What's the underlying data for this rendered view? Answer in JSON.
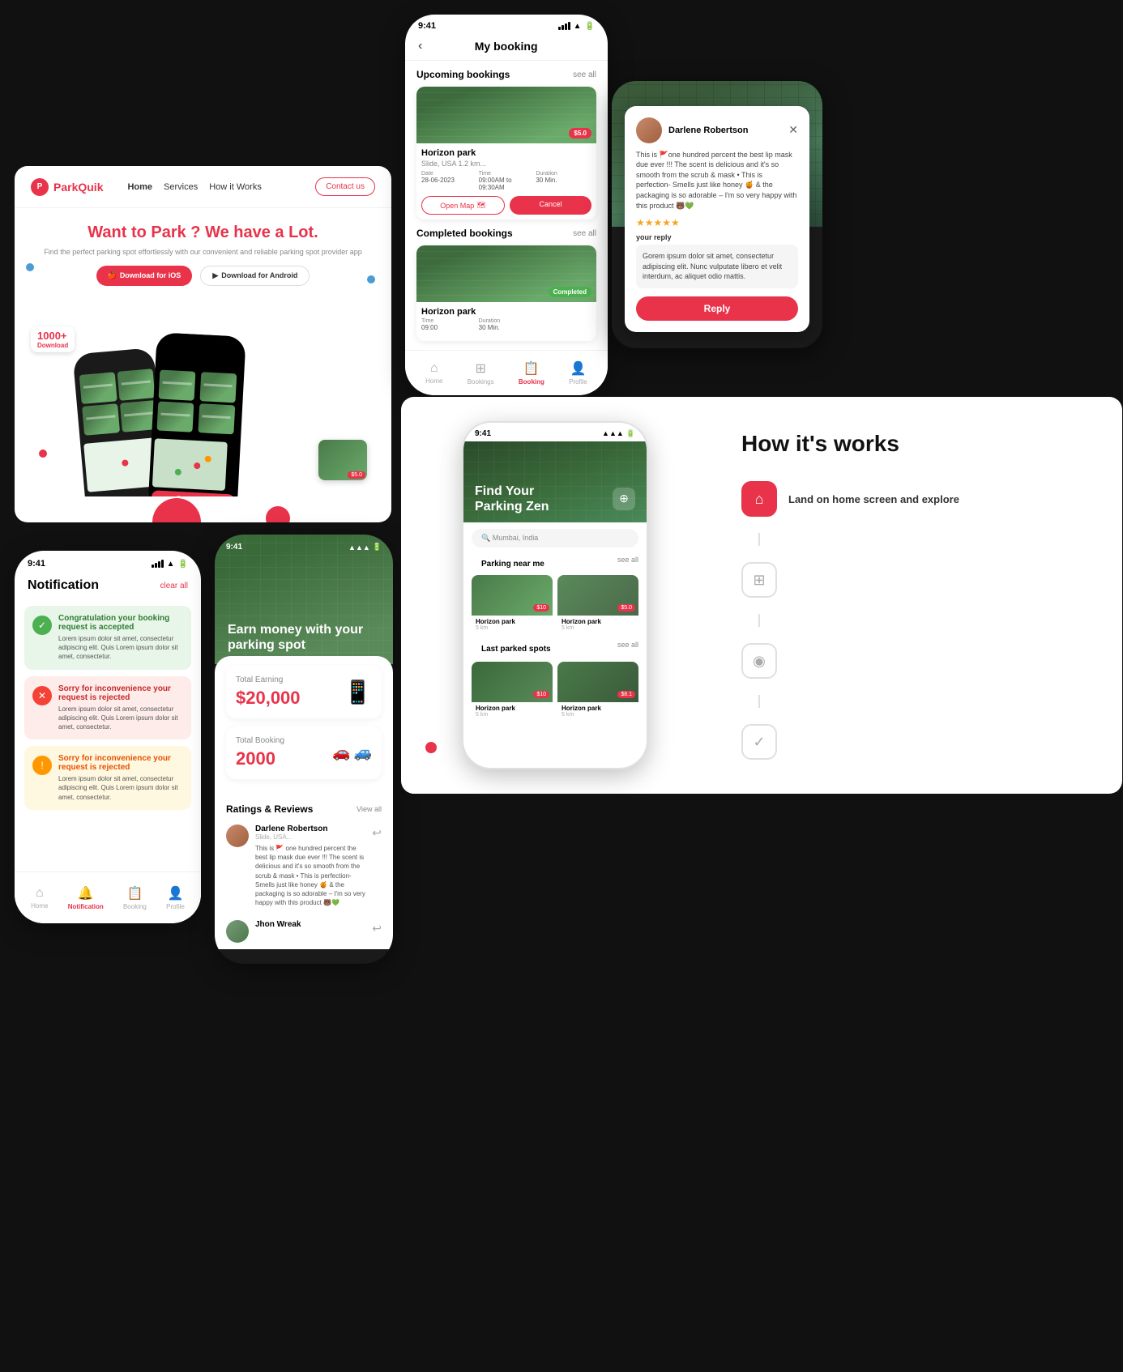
{
  "website": {
    "logo_text": "ParkQuik",
    "nav_links": [
      "Home",
      "Services",
      "How it Works"
    ],
    "contact_label": "Contact us",
    "hero_title": "Want to Park ? We have a Lot.",
    "hero_sub": "Find the perfect parking spot effortlessly with our convenient and reliable parking spot provider app",
    "dl_ios": "Download for iOS",
    "dl_android": "Download for Android",
    "badge_count": "1000+",
    "badge_label": "Download"
  },
  "booking_screen": {
    "time": "9:41",
    "title": "My booking",
    "upcoming_label": "Upcoming bookings",
    "see_all": "see all",
    "completed_label": "Completed bookings",
    "park1_name": "Horizon park",
    "park1_loc": "Slide, USA 1.2 km...",
    "park1_price": "$5.0",
    "park1_date": "28-06-2023",
    "park1_time": "09:00AM to 09:30AM",
    "park1_duration": "30 Min.",
    "date_label": "Date",
    "time_label": "Time",
    "duration_label": "Duration",
    "open_map_btn": "Open Map",
    "cancel_btn": "Cancel",
    "park2_name": "Horizon park",
    "park2_status": "Completed",
    "nav_home": "Home",
    "nav_bookings": "Bookings",
    "nav_booking_active": "Booking",
    "nav_profile": "Profile"
  },
  "earn_dark": {
    "time": "9:41",
    "title": "Earn money with your parking spot",
    "reviewer_name": "Darlene Robertson",
    "review_text": "This is 🚩one hundred percent the best lip mask due ever !!! The scent is delicious and it's so smooth from the scrub & mask • This is perfection- Smells just like honey 🍯 & the packaging is so adorable – I'm so very happy with this product 🐻💚",
    "stars": "★★★★★",
    "your_reply_label": "your reply",
    "reply_placeholder": "Gorem ipsum dolor sit amet, consectetur adipiscing elit. Nunc vulputate libero et velit interdum, ac aliquet odio mattis.",
    "reply_btn": "Reply"
  },
  "notifications": {
    "time": "9:41",
    "title": "Notification",
    "clear_all": "clear all",
    "notif1_title": "Congratulation your booking request is accepted",
    "notif1_body": "Lorem ipsum dolor sit amet, consectetur adipiscing elit. Quis Lorem ipsum dolor sit amet, consectetur.",
    "notif2_title": "Sorry for inconvenience your request is rejected",
    "notif2_body": "Lorem ipsum dolor sit amet, consectetur adipiscing elit. Quis Lorem ipsum dolor sit amet, consectetur.",
    "notif3_title": "Sorry for inconvenience your request is rejected",
    "notif3_body": "Lorem ipsum dolor sit amet, consectetur adipiscing elit. Quis Lorem ipsum dolor sit amet, consectetur."
  },
  "earn_light": {
    "time": "9:41",
    "title": "Earn money with your parking spot",
    "total_earning_label": "Total Earning",
    "total_earning_value": "$20,000",
    "total_booking_label": "Total Booking",
    "total_booking_value": "2000",
    "ratings_title": "Ratings & Reviews",
    "view_all": "View all",
    "reviewer1_name": "Darlene Robertson",
    "reviewer1_date": "Slide, USA...",
    "reviewer1_text": "This is 🚩 one hundred percent the best lip mask due ever !!! The scent is delicious and it's so smooth from the scrub & mask • This is perfection- Smells just like honey 🍯 & the packaging is so adorable – I'm so very happy with this product 🐻💚",
    "reviewer2_name": "Jhon Wreak"
  },
  "find_parking": {
    "time": "9:41",
    "title": "Find Your\nParking Zen",
    "search_placeholder": "Mumbai, India",
    "nearby_label": "Parking near me",
    "see_all": "see all",
    "last_parked_label": "Last parked spots",
    "see_all2": "see all",
    "park1_name": "Horizon park",
    "park1_loc": "5 km",
    "park1_price": "$10",
    "park2_name": "Horizon park",
    "park2_loc": "5 km",
    "park2_price": "$5.0",
    "park3_name": "Horizon park",
    "park3_loc": "5 km",
    "park3_price": "$10",
    "park4_name": "Horizon park",
    "park4_loc": "5 km",
    "park4_price": "$8.1"
  },
  "how_it_works": {
    "title": "How it's works",
    "step1": "Land on home screen and explore",
    "step2": "",
    "step3": "",
    "step4": ""
  }
}
